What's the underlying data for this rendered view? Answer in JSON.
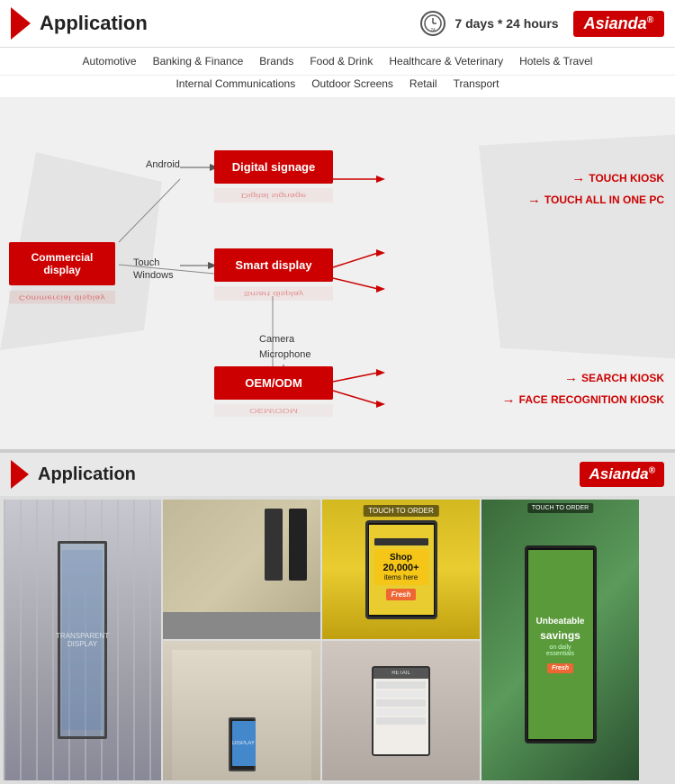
{
  "header": {
    "title": "Application",
    "hours_text": "7 days * 24 hours",
    "logo_text": "Asianda",
    "logo_suffix": "®"
  },
  "nav": {
    "items": [
      "Automotive",
      "Banking & Finance",
      "Brands",
      "Food & Drink",
      "Healthcare & Veterinary",
      "Hotels & Travel",
      "Internal Communications",
      "Outdoor Screens",
      "Retail",
      "Transport"
    ]
  },
  "diagram": {
    "commercial_label": "Commercial display",
    "digital_label": "Digital signage",
    "smart_label": "Smart display",
    "oem_label": "OEM/ODM",
    "lbl_android": "Android",
    "lbl_touch": "Touch\nWindows",
    "lbl_camera": "Camera\nMicrophone\n....",
    "right_labels": [
      "TOUCH KIOSK",
      "TOUCH ALL IN ONE PC",
      "SEARCH KIOSK",
      "FACE RECOGNITION KIOSK"
    ]
  },
  "bottom": {
    "title": "Application",
    "logo_text": "Asianda",
    "logo_suffix": "®"
  },
  "photos": {
    "touch_to_order": "TOUCH TO ORDER",
    "shop_big": "Shop",
    "shop_num": "20,000+",
    "shop_sub": "items here",
    "fresh_label": "Fresh",
    "unbeatable": "Unbeatable",
    "savings": "savings",
    "daily": "on daily essentials"
  }
}
